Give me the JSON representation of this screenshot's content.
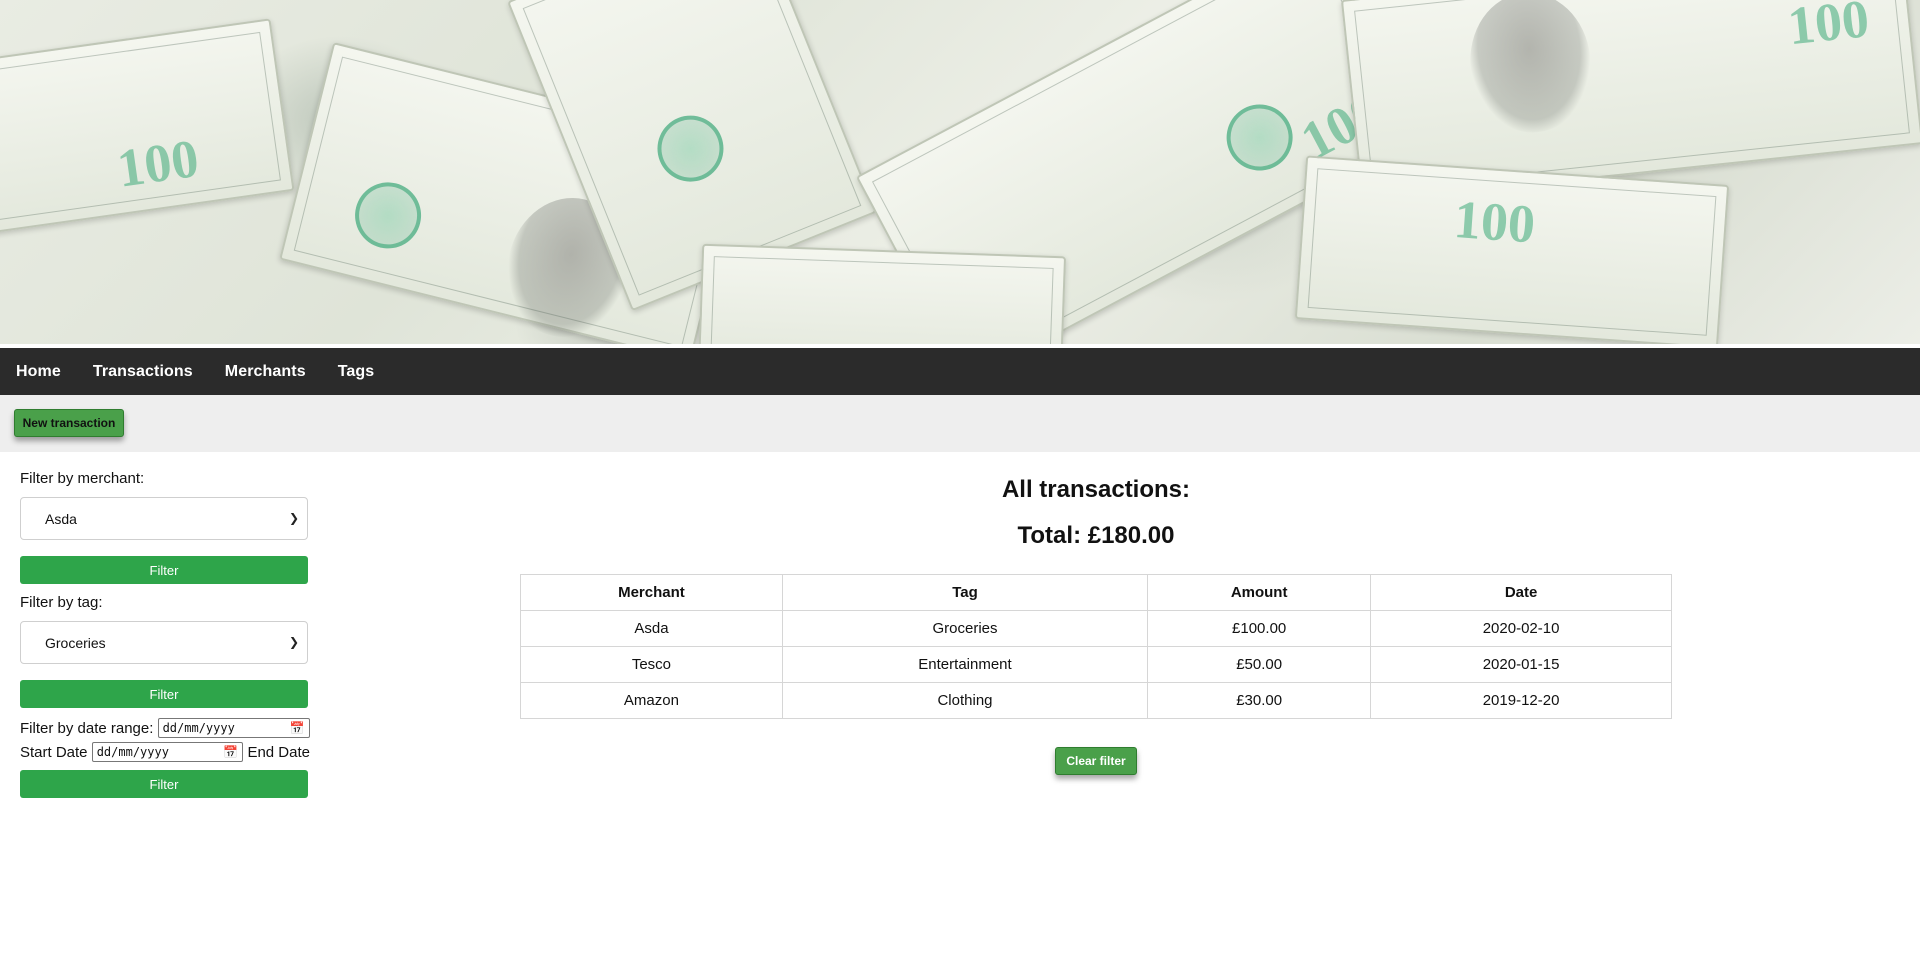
{
  "nav": {
    "items": [
      {
        "label": "Home"
      },
      {
        "label": "Transactions"
      },
      {
        "label": "Merchants"
      },
      {
        "label": "Tags"
      }
    ]
  },
  "actions": {
    "new_transaction_label": "New transaction"
  },
  "filters": {
    "merchant_label": "Filter by merchant:",
    "merchant_selected": "Asda",
    "merchant_button": "Filter",
    "tag_label": "Filter by tag:",
    "tag_selected": "Groceries",
    "tag_button": "Filter",
    "date_range_label": "Filter by date range:",
    "start_date_label": "Start Date",
    "end_date_label": "End Date",
    "date_placeholder": "dd/mm/yyyy",
    "date_button": "Filter"
  },
  "main": {
    "heading": "All transactions:",
    "total": "Total: £180.00",
    "clear_filter_label": "Clear filter",
    "table": {
      "headers": [
        "Merchant",
        "Tag",
        "Amount",
        "Date"
      ],
      "rows": [
        [
          "Asda",
          "Groceries",
          "£100.00",
          "2020-02-10"
        ],
        [
          "Tesco",
          "Entertainment",
          "£50.00",
          "2020-01-15"
        ],
        [
          "Amazon",
          "Clothing",
          "£30.00",
          "2019-12-20"
        ]
      ]
    }
  },
  "colors": {
    "navbar": "#2b2b2b",
    "action_strip": "#eeeeee",
    "filter_button": "#2ea54a",
    "accent_button": "#4aa04a"
  },
  "icons": {
    "select_arrow": "chevron-down-icon",
    "date_picker": "calendar-icon"
  }
}
